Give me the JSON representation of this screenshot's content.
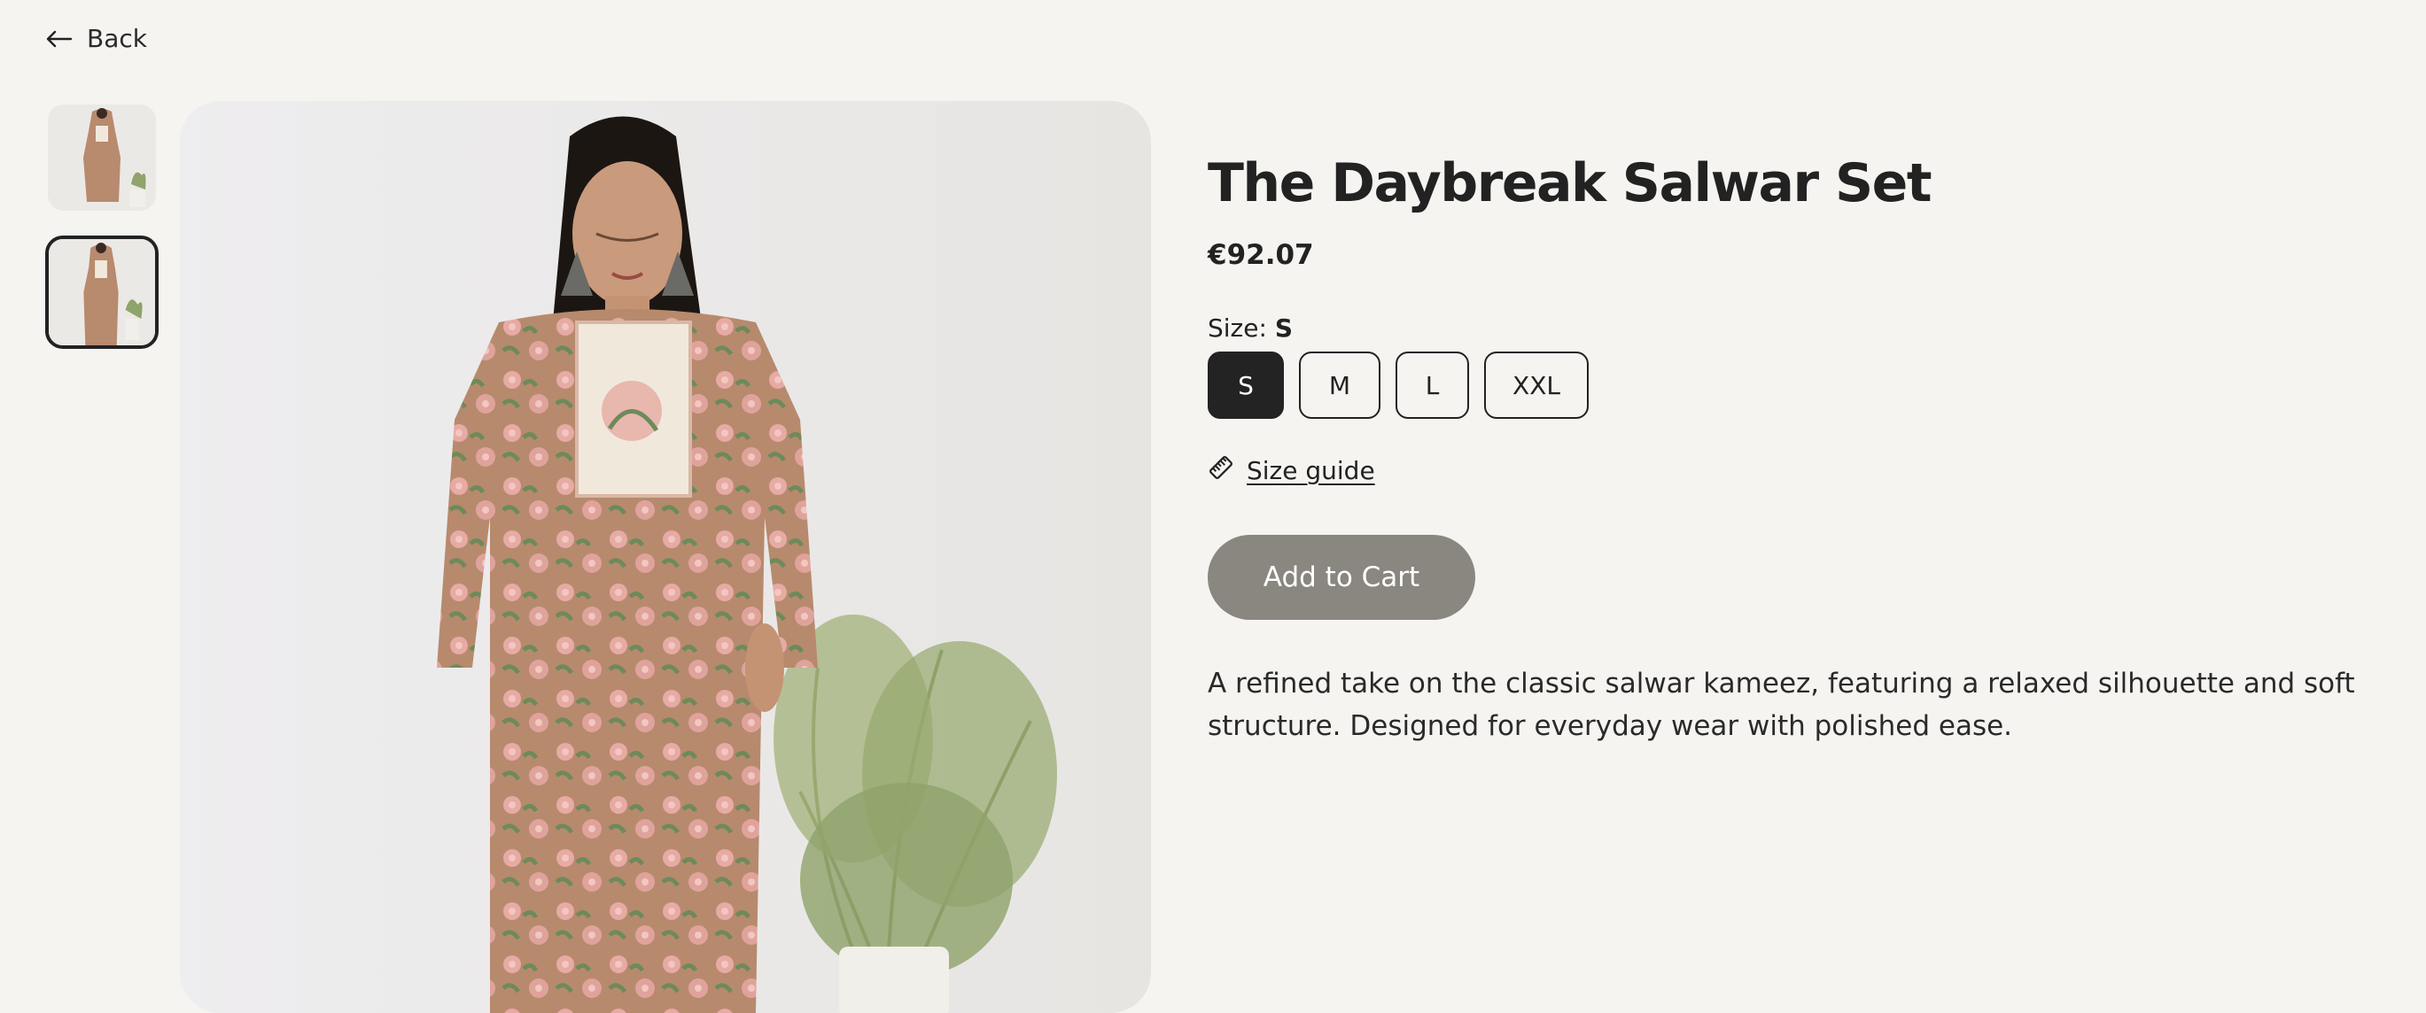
{
  "nav": {
    "back_label": "Back",
    "back_icon": "arrow-left-icon"
  },
  "gallery": {
    "thumbnails": [
      {
        "name": "thumbnail-1",
        "selected": false
      },
      {
        "name": "thumbnail-2",
        "selected": true
      }
    ],
    "main_image": "model-wearing-floral-salwar-set"
  },
  "product": {
    "title": "The Daybreak Salwar Set",
    "price": "€92.07",
    "size_prefix": "Size:",
    "selected_size": "S",
    "sizes": [
      "S",
      "M",
      "L",
      "XXL"
    ],
    "size_guide_label": "Size guide",
    "size_guide_icon": "ruler-icon",
    "add_to_cart_label": "Add to Cart",
    "description": "A refined take on the classic salwar kameez, featuring a relaxed silhouette and soft structure. Designed for everyday wear with polished ease."
  },
  "colors": {
    "background": "#f5f4f1",
    "text": "#222222",
    "selected_size_bg": "#232323",
    "cart_button_bg": "#8a8680",
    "garment": "#b88a6e",
    "yoke": "#f1e8dc",
    "plant": "#8fa36a"
  }
}
